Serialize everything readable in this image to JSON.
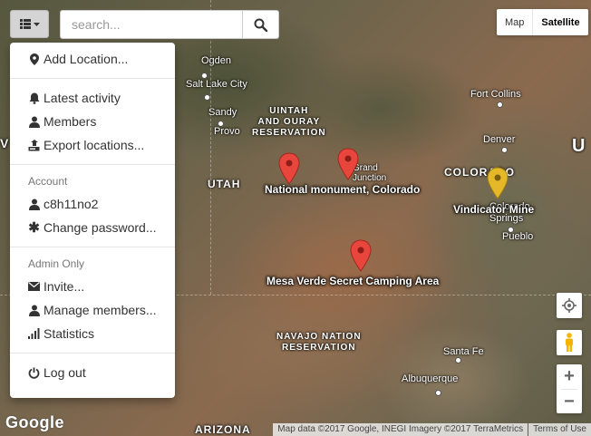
{
  "toolbar": {
    "menu_icon": "list-icon",
    "search_placeholder": "search..."
  },
  "dropdown": {
    "add_location": "Add Location...",
    "latest_activity": "Latest activity",
    "members": "Members",
    "export_locations": "Export locations...",
    "account_header": "Account",
    "username": "c8h11no2",
    "change_password": "Change password...",
    "admin_header": "Admin Only",
    "invite": "Invite...",
    "manage_members": "Manage members...",
    "statistics": "Statistics",
    "log_out": "Log out"
  },
  "map_type": {
    "map": "Map",
    "satellite": "Satellite",
    "selected": "Satellite"
  },
  "map_labels": {
    "ogden": "Ogden",
    "salt_lake_city": "Salt Lake City",
    "sandy": "Sandy",
    "provo": "Provo",
    "uintah_line1": "UINTAH",
    "uintah_line2": "AND OURAY",
    "uintah_line3": "RESERVATION",
    "utah": "UTAH",
    "grand_junction": "Grand Junction",
    "fort_collins": "Fort Collins",
    "denver": "Denver",
    "colorado": "COLORADO",
    "colorado_springs": "Colorado Springs",
    "pueblo": "Pueblo",
    "navajo_line1": "NAVAJO NATION",
    "navajo_line2": "RESERVATION",
    "santa_fe": "Santa Fe",
    "albuquerque": "Albuquerque",
    "arizona": "ARIZONA",
    "edge_left": "V",
    "edge_right": "U"
  },
  "markers": [
    {
      "label": "National monument, Colorado",
      "color": "#e8463c"
    },
    {
      "label": "",
      "color": "#e8463c"
    },
    {
      "label": "Vindicator Mine",
      "color": "#e5b82a"
    },
    {
      "label": "Mesa Verde Secret Camping Area",
      "color": "#e8463c"
    }
  ],
  "attribution": {
    "map_data": "Map data ©2017 Google, INEGI Imagery ©2017 TerraMetrics",
    "terms": "Terms of Use",
    "logo": "Google"
  },
  "controls": {
    "zoom_in": "+",
    "zoom_out": "−"
  }
}
